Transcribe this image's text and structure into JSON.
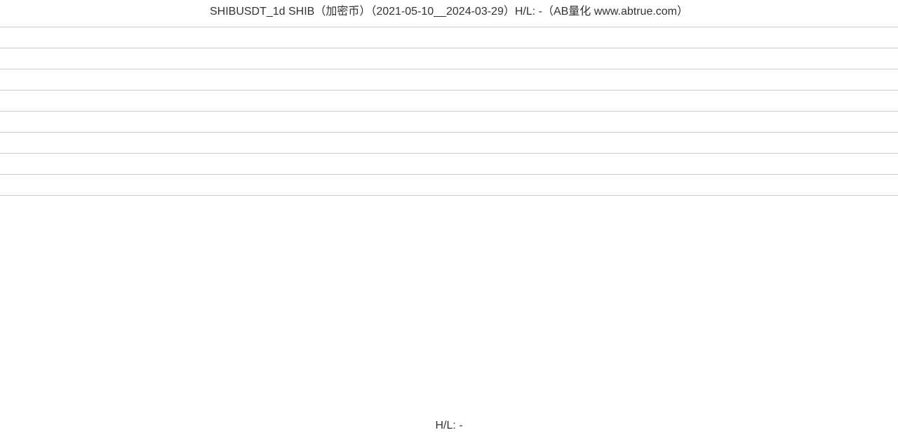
{
  "chart_data": {
    "type": "line",
    "title": "SHIBUSDT_1d SHIB（加密币）（2021-05-10__2024-03-29）H/L: -（AB量化  www.abtrue.com）",
    "subtitle": "H/L: -",
    "symbol": "SHIBUSDT",
    "interval": "1d",
    "asset_name": "SHIB",
    "asset_category": "加密币",
    "date_range_start": "2021-05-10",
    "date_range_end": "2024-03-29",
    "hl_ratio": "-",
    "source": "AB量化  www.abtrue.com",
    "gridlines_y_count": 8,
    "series": [],
    "x": [],
    "xlabel": "",
    "ylabel": ""
  }
}
